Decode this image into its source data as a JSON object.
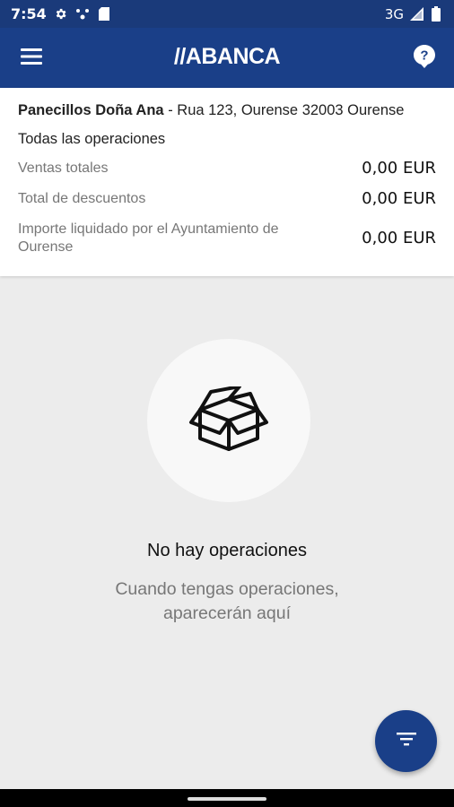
{
  "status_bar": {
    "time": "7:54",
    "network": "3G",
    "icons": [
      "settings-icon",
      "notification-dots-icon",
      "sim-icon",
      "signal-icon",
      "battery-icon"
    ]
  },
  "app_bar": {
    "logo": "//ABANCA",
    "menu_icon": "hamburger-menu-icon",
    "help_icon": "help-bubble-icon",
    "color": "#1a3f88"
  },
  "summary": {
    "merchant_name": "Panecillos Doña Ana",
    "merchant_address": " - Rua 123, Ourense 32003 Ourense",
    "section_title": "Todas las operaciones",
    "rows": [
      {
        "label": "Ventas totales",
        "amount": "0,00 EUR"
      },
      {
        "label": "Total de descuentos",
        "amount": "0,00 EUR"
      },
      {
        "label": "Importe liquidado por el Ayuntamiento de Ourense",
        "amount": "0,00 EUR"
      }
    ]
  },
  "empty_state": {
    "icon": "open-box-icon",
    "title": "No hay operaciones",
    "subtitle_line1": "Cuando tengas operaciones,",
    "subtitle_line2": "aparecerán aquí"
  },
  "fab": {
    "icon": "filter-icon"
  }
}
